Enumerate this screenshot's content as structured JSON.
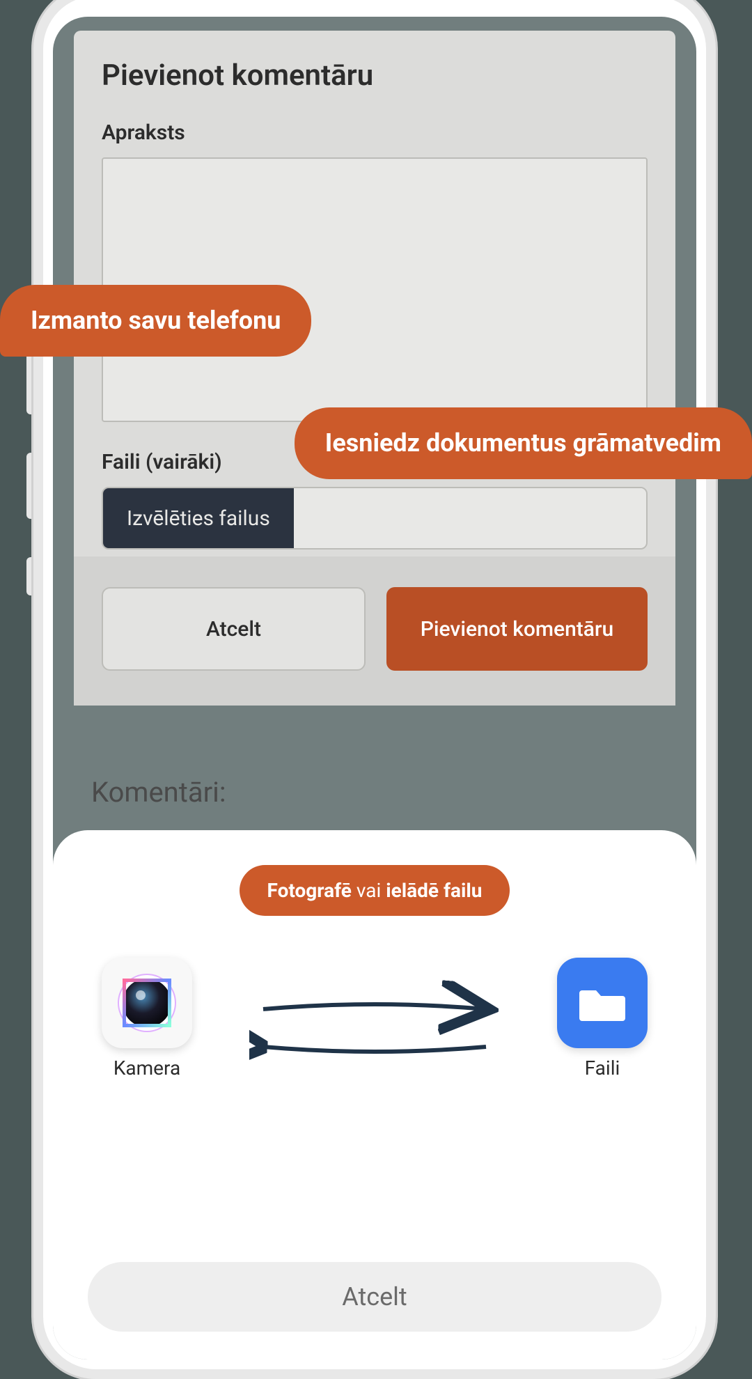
{
  "modal": {
    "title": "Pievienot komentāru",
    "description_label": "Apraksts",
    "files_label": "Faili (vairāki)",
    "choose_files_button": "Izvēlēties failus",
    "cancel_button": "Atcelt",
    "submit_button": "Pievienot komentāru"
  },
  "background": {
    "comments_label": "Komentāri:"
  },
  "sheet": {
    "pill_bold_1": "Fotografē",
    "pill_plain": " vai ",
    "pill_bold_2": "ielādē failu",
    "camera_label": "Kamera",
    "files_label": "Faili",
    "cancel_button": "Atcelt"
  },
  "callouts": {
    "c1": "Izmanto savu telefonu",
    "c2": "Iesniedz dokumentus grāmatvedim"
  }
}
